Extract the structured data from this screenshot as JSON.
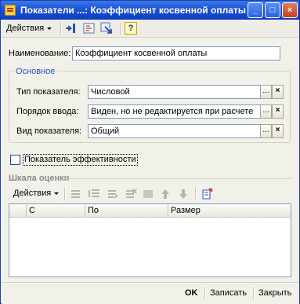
{
  "window": {
    "title": "Показатели ...: Коэффициент косвенной оплаты",
    "minimize_glyph": "_",
    "maximize_glyph": "□",
    "close_glyph": "×"
  },
  "toolbar": {
    "actions_label": "Действия",
    "help_glyph": "?"
  },
  "form": {
    "name_label": "Наименование:",
    "name_value": "Коэффициент косвенной оплаты",
    "group_title": "Основное",
    "type_label": "Тип показателя:",
    "type_value": "Числовой",
    "input_order_label": "Порядок ввода:",
    "input_order_value": "Виден, но не редактируется при расчете",
    "kind_label": "Вид показателя:",
    "kind_value": "Общий",
    "select_glyph": "...",
    "clear_glyph": "×",
    "efficiency_checkbox_label": "Показатель эффективности",
    "efficiency_checked": false
  },
  "scale": {
    "section_title": "Шкала оценки",
    "actions_label": "Действия",
    "columns": [
      "С",
      "По",
      "Размер"
    ]
  },
  "footer": {
    "ok_label": "OK",
    "save_label": "Записать",
    "close_label": "Закрыть"
  },
  "colors": {
    "title_bar": "#1b52d4",
    "group_title": "#2b50c8",
    "window_bg": "#f2f1e9"
  }
}
